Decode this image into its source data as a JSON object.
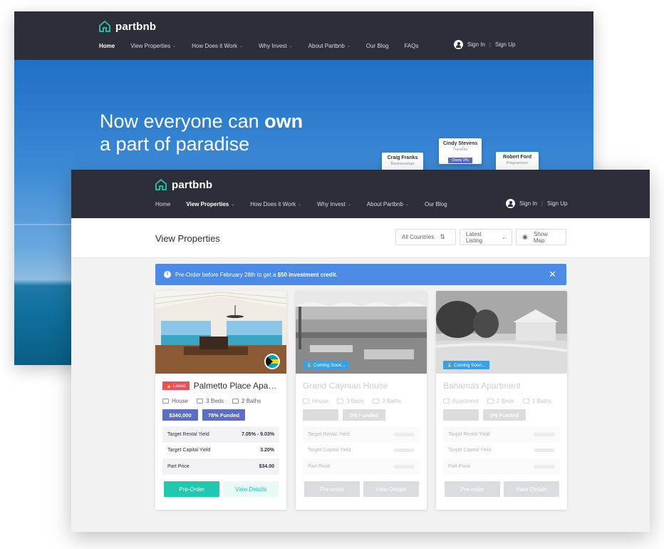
{
  "back": {
    "logo": "partbnb",
    "nav": [
      {
        "label": "Home"
      },
      {
        "label": "View Properties"
      },
      {
        "label": "How Does it Work"
      },
      {
        "label": "Why Invest"
      },
      {
        "label": "About Partbnb"
      },
      {
        "label": "Our Blog"
      },
      {
        "label": "FAQs"
      }
    ],
    "sign_in": "Sign In",
    "sign_up": "Sign Up",
    "hero_line1_pre": "Now everyone can ",
    "hero_line1_bold": "own",
    "hero_line2": "a part of paradise",
    "people": [
      {
        "name": "Craig Franks",
        "role": "Businessman",
        "badge": ""
      },
      {
        "name": "Cindy Stevens",
        "role": "Traveller",
        "badge": "Owns 3%"
      },
      {
        "name": "Robert Ford",
        "role": "Programmer",
        "badge": ""
      }
    ]
  },
  "front": {
    "logo": "partbnb",
    "nav": [
      {
        "label": "Home"
      },
      {
        "label": "View Properties"
      },
      {
        "label": "How Does it Work"
      },
      {
        "label": "Why Invest"
      },
      {
        "label": "About Partbnb"
      },
      {
        "label": "Our Blog"
      }
    ],
    "sign_in": "Sign In",
    "sign_up": "Sign Up",
    "page_title": "View Properties",
    "filters": {
      "country": "All Countries",
      "sort": "Latest Listing",
      "map": "Show Map"
    },
    "banner": {
      "pre": "Pre-Order before February 28th to get a ",
      "bold": "$50 investment credit."
    },
    "cards": [
      {
        "tag": "Latest",
        "title": "Palmetto Place Apart...",
        "type": "House",
        "beds": "3 Beds",
        "baths": "2 Baths",
        "price": "$340,000",
        "funded": "78% Funded",
        "rows": [
          {
            "label": "Target Rental Yield",
            "value": "7.05% - 9.03%"
          },
          {
            "label": "Target Capital Yield",
            "value": "3.20%"
          },
          {
            "label": "Part Price",
            "value": "$34.00"
          }
        ],
        "primary": "Pre-Order",
        "secondary": "View Details"
      },
      {
        "badge": "Coming Soon...",
        "title": "Grand Cayman House",
        "type": "House",
        "beds": "3 Beds",
        "baths": "3 Baths",
        "funded": "0% Funded",
        "rows": [
          {
            "label": "Target Rental Yield"
          },
          {
            "label": "Target Capital Yield"
          },
          {
            "label": "Part Price"
          }
        ],
        "primary": "Pre-order",
        "secondary": "View Details"
      },
      {
        "badge": "Coming Soon...",
        "title": "Bahamas Apartment",
        "type": "Apartment",
        "beds": "2 Beds",
        "baths": "1 Baths",
        "funded": "0% Funded",
        "rows": [
          {
            "label": "Target Rental Yield"
          },
          {
            "label": "Target Capital Yield"
          },
          {
            "label": "Part Price"
          }
        ],
        "primary": "Pre-order",
        "secondary": "View Details"
      }
    ]
  },
  "colors": {
    "nav_bg": "#2c2f3a",
    "accent_teal": "#1ec9b0",
    "banner_blue": "#4b8be6",
    "pill_blue": "#5b6dc4",
    "latest_red": "#e8505b"
  }
}
